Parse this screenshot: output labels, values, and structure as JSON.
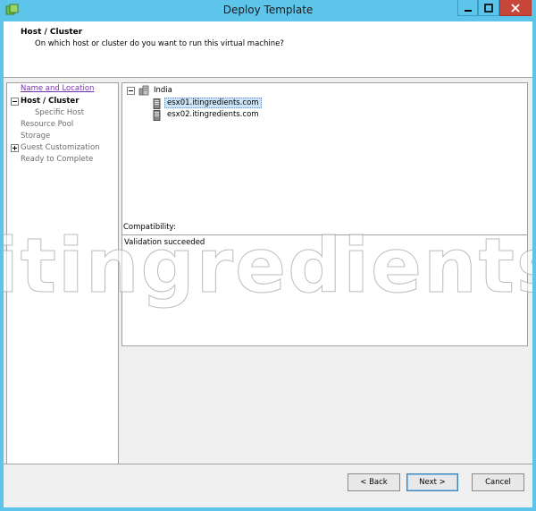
{
  "window": {
    "title": "Deploy Template",
    "controls": {
      "minimize": "minimize",
      "maximize": "maximize",
      "close": "close"
    }
  },
  "header": {
    "title": "Host / Cluster",
    "subtitle": "On which host or cluster do you want to run this virtual machine?"
  },
  "nav": {
    "items": [
      {
        "label": "Name and Location",
        "state": "link"
      },
      {
        "label": "Host / Cluster",
        "state": "active"
      },
      {
        "label": "Specific Host",
        "state": "sub"
      },
      {
        "label": "Resource Pool",
        "state": "normal"
      },
      {
        "label": "Storage",
        "state": "normal"
      },
      {
        "label": "Guest Customization",
        "state": "normal"
      },
      {
        "label": "Ready to Complete",
        "state": "normal"
      }
    ]
  },
  "tree": {
    "datacenter": "India",
    "hosts": [
      {
        "label": "esx01.itingredients.com",
        "selected": true
      },
      {
        "label": "esx02.itingredients.com",
        "selected": false
      }
    ]
  },
  "compatibility": {
    "label": "Compatibility:",
    "message": "Validation succeeded"
  },
  "watermark": "itingredients.c",
  "buttons": {
    "back": "< Back",
    "next": "Next >",
    "cancel": "Cancel"
  },
  "colors": {
    "titlebar": "#5ec5ea",
    "close_button": "#c7463a",
    "link": "#7a2fb0",
    "selection": "#cce4f7"
  }
}
